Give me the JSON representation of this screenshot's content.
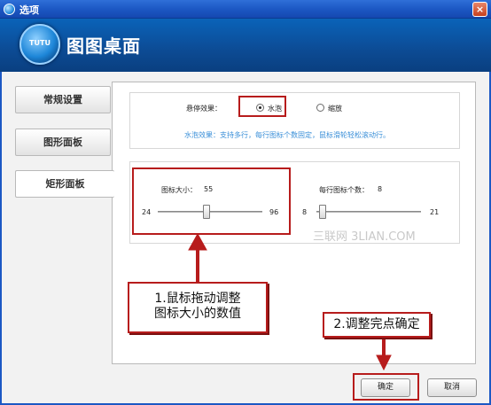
{
  "window": {
    "title": "选项",
    "close_label": "×"
  },
  "header": {
    "logo_text": "TUTU",
    "app_name": "图图桌面"
  },
  "sidebar": {
    "tabs": [
      {
        "label": "常规设置",
        "active": false
      },
      {
        "label": "图形面板",
        "active": false
      },
      {
        "label": "矩形面板",
        "active": true
      }
    ]
  },
  "hover": {
    "label": "悬停效果：",
    "options": [
      {
        "label": "水泡",
        "selected": true
      },
      {
        "label": "缩放",
        "selected": false
      }
    ],
    "description": "水泡效果：支持多行，每行图标个数固定，鼠标滑轮轻松滚动行。"
  },
  "icon_size": {
    "label": "图标大小：",
    "value": "55",
    "min": "24",
    "max": "96"
  },
  "per_row": {
    "label": "每行图标个数：",
    "value": "8",
    "min": "8",
    "max": "21"
  },
  "annotations": {
    "callout1_line1": "1.鼠标拖动调整",
    "callout1_line2": "图标大小的数值",
    "callout2": "2.调整完点确定",
    "color": "#b71c1c"
  },
  "watermark": "三联网 3LIAN.COM",
  "buttons": {
    "ok": "确定",
    "cancel": "取消"
  }
}
